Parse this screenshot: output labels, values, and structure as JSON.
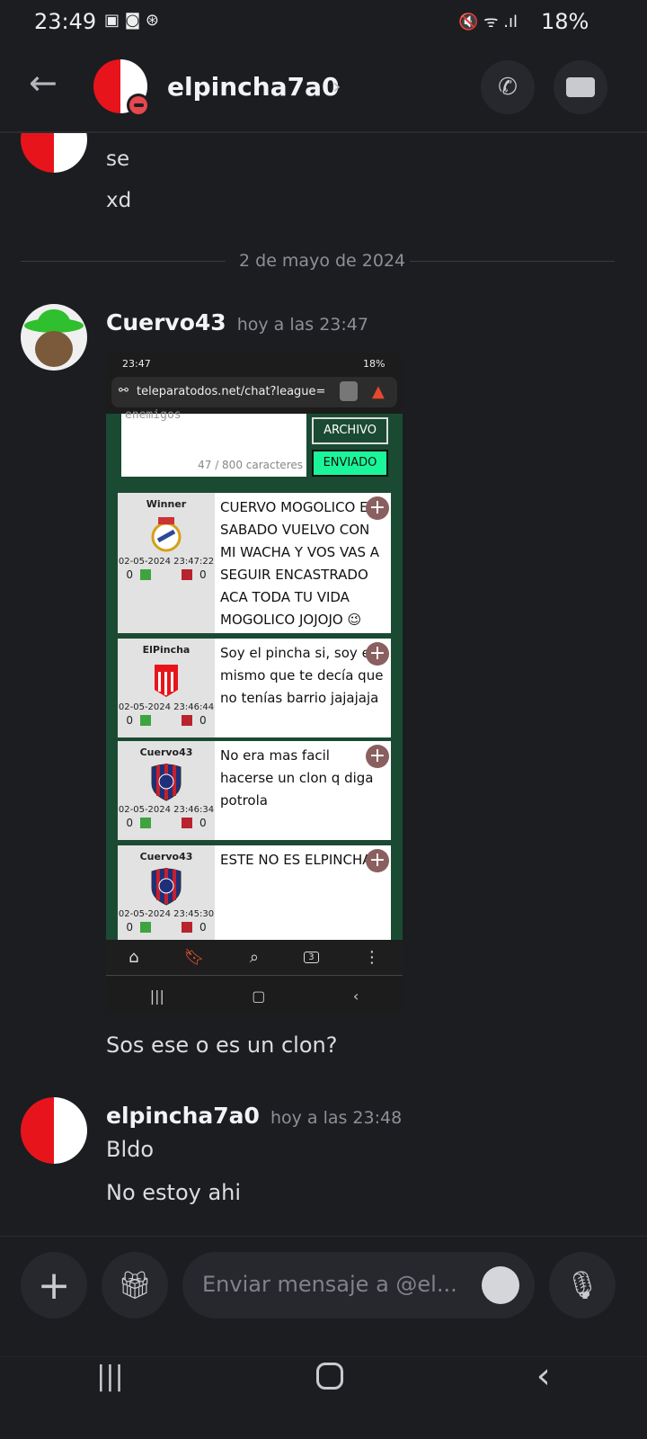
{
  "status_bar": {
    "time": "23:49",
    "battery": "18%"
  },
  "header": {
    "username": "elpincha7a0",
    "chevron": "›"
  },
  "messages_top": [
    "se",
    "xd"
  ],
  "date_divider": "2 de mayo de 2024",
  "msg1": {
    "author": "Cuervo43",
    "time": "hoy a las 23:47",
    "text": "Sos ese o es un clon?"
  },
  "screenshot": {
    "time": "23:47",
    "battery": "18%",
    "url": "teleparatodos.net/chat?league=co|",
    "textarea_text": "enemigos",
    "char_count": "47 / 800 caracteres",
    "archivo_label": "ARCHIVO",
    "enviado_label": "ENVIADO",
    "tab_count": "3",
    "posts": [
      {
        "user": "Winner",
        "date": "02-05-2024 23:47:22",
        "up": "0",
        "down": "0",
        "text": "CUERVO MOGOLICO EL SABADO VUELVO CON MI WACHA Y VOS VAS A SEGUIR ENCASTRADO ACA TODA TU VIDA MOGOLICO JOJOJO 😉"
      },
      {
        "user": "ElPincha",
        "date": "02-05-2024 23:46:44",
        "up": "0",
        "down": "0",
        "text": "Soy el pincha si, soy el mismo que te decía que no tenías barrio jajajaja"
      },
      {
        "user": "Cuervo43",
        "date": "02-05-2024 23:46:34",
        "up": "0",
        "down": "0",
        "text": "No era mas facil hacerse un clon q diga potrola"
      },
      {
        "user": "Cuervo43",
        "date": "02-05-2024 23:45:30",
        "up": "0",
        "down": "0",
        "text": "ESTE NO ES ELPINCHA"
      }
    ]
  },
  "msg2": {
    "author": "elpincha7a0",
    "time": "hoy a las 23:48",
    "lines": [
      "Bldo",
      "No estoy ahi"
    ]
  },
  "composer": {
    "placeholder": "Enviar mensaje a @el..."
  }
}
